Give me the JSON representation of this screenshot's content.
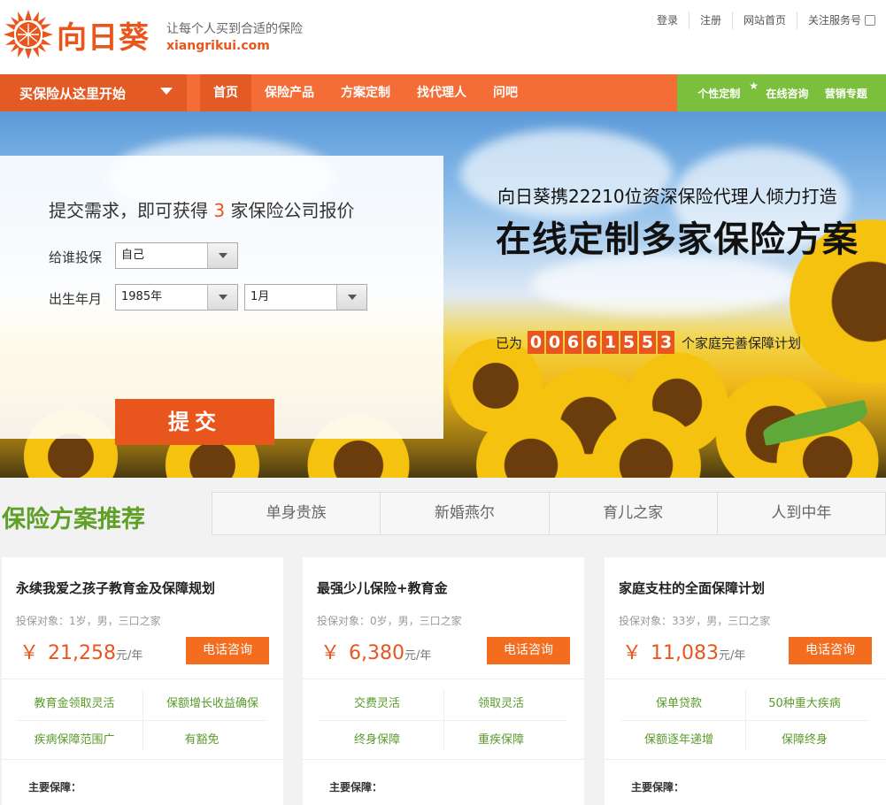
{
  "brand": {
    "name": "向日葵",
    "slogan": "让每个人买到合适的保险",
    "domain": "xiangrikui.com"
  },
  "top_links": [
    "登录",
    "注册",
    "网站首页",
    "关注服务号"
  ],
  "nav": {
    "start_label": "买保险从这里开始",
    "items": [
      "首页",
      "保险产品",
      "方案定制",
      "找代理人",
      "问吧"
    ],
    "green_items": [
      "个性定制",
      "在线咨询",
      "营销专题"
    ]
  },
  "form": {
    "title_pre": "提交需求，即可获得",
    "title_num": "3",
    "title_post": "家保险公司报价",
    "who_label": "给谁投保",
    "who_value": "自己",
    "birth_label": "出生年月",
    "year_value": "1985年",
    "month_value": "1月",
    "submit_label": "提交"
  },
  "banner": {
    "line1": "向日葵携22210位资深保险代理人倾力打造",
    "line2": "在线定制多家保险方案",
    "counter_pre": "已为",
    "counter_digits": [
      "0",
      "0",
      "6",
      "6",
      "1",
      "5",
      "5",
      "3"
    ],
    "counter_post": "个家庭完善保障计划"
  },
  "recommend": {
    "title": "保险方案推荐",
    "tabs": [
      "单身贵族",
      "新婚燕尔",
      "育儿之家",
      "人到中年"
    ],
    "call_label": "电话咨询",
    "main_label": "主要保障：",
    "yen": "￥",
    "unit": "元/年",
    "cards": [
      {
        "title": "永续我爱之孩子教育金及保障规划",
        "target": "投保对象：1岁，男，三口之家",
        "price": "21,258",
        "features": [
          "教育金领取灵活",
          "保额增长收益确保",
          "疾病保障范围广",
          "有豁免"
        ]
      },
      {
        "title": "最强少儿保险+教育金",
        "target": "投保对象：0岁，男，三口之家",
        "price": "6,380",
        "features": [
          "交费灵活",
          "领取灵活",
          "终身保障",
          "重疾保障"
        ]
      },
      {
        "title": "家庭支柱的全面保障计划",
        "target": "投保对象：33岁，男，三口之家",
        "price": "11,083",
        "features": [
          "保单贷款",
          "50种重大疾病",
          "保额逐年递增",
          "保障终身"
        ]
      }
    ]
  },
  "colors": {
    "brand_orange": "#e8561d",
    "nav_orange": "#f46c36",
    "green": "#7bbf3c"
  }
}
